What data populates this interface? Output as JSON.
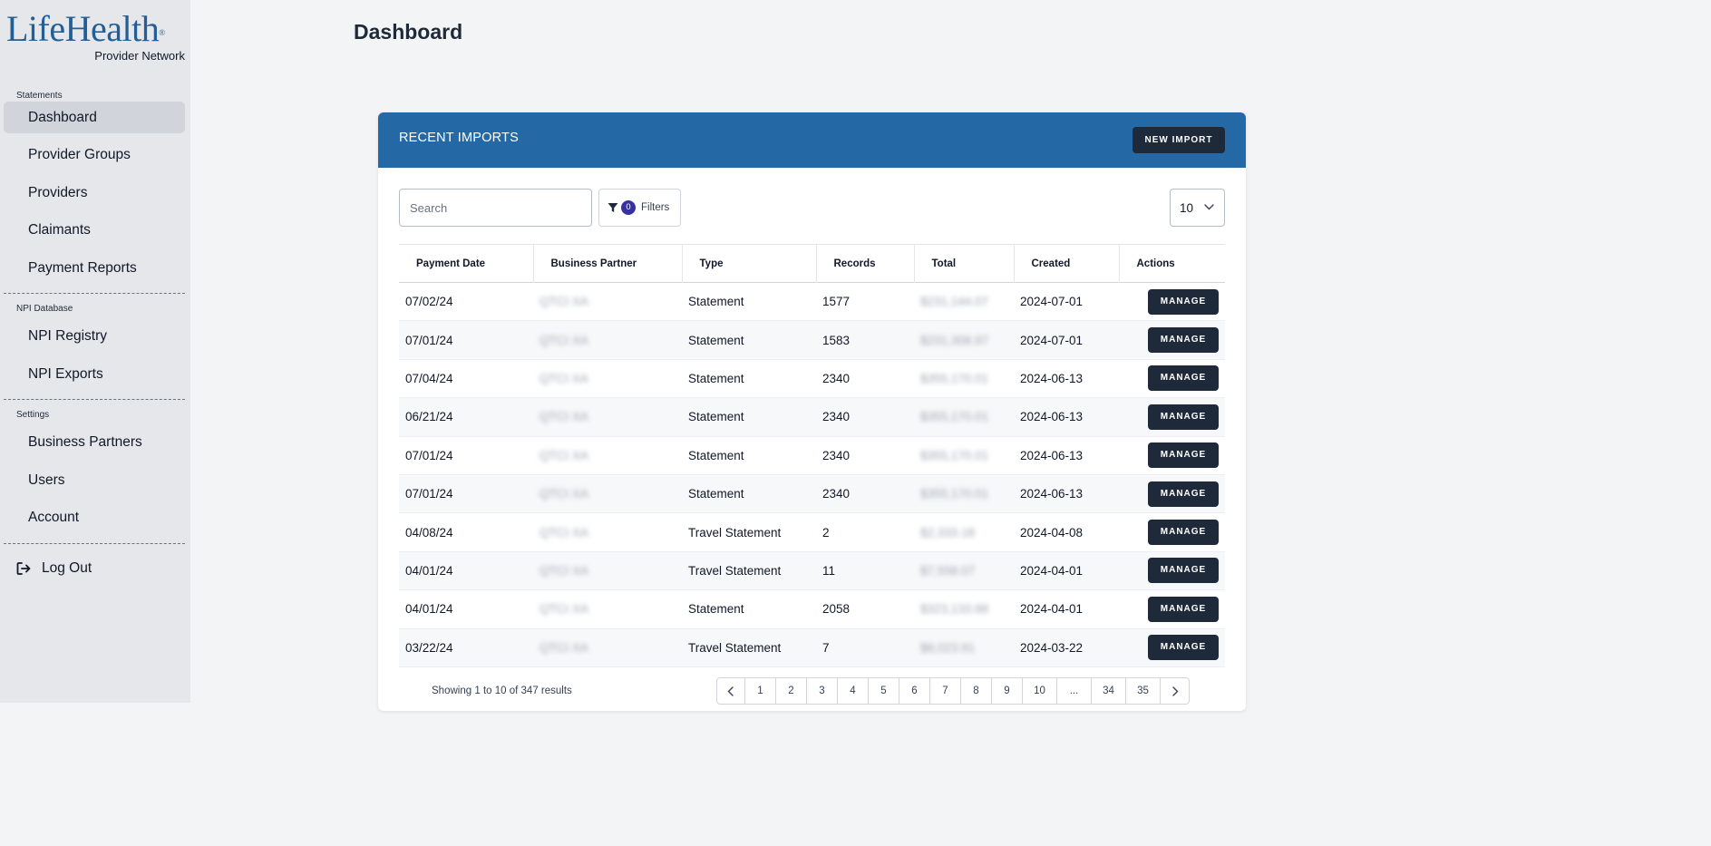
{
  "brand": {
    "name": "LifeHealth",
    "registered": "®",
    "subtitle": "Provider Network"
  },
  "sidebar": {
    "sections": [
      {
        "label": "Statements",
        "items": [
          "Dashboard",
          "Provider Groups",
          "Providers",
          "Claimants",
          "Payment Reports"
        ]
      },
      {
        "label": "NPI Database",
        "items": [
          "NPI Registry",
          "NPI Exports"
        ]
      },
      {
        "label": "Settings",
        "items": [
          "Business Partners",
          "Users",
          "Account"
        ]
      }
    ],
    "active_item": "Dashboard",
    "logout_label": "Log Out"
  },
  "page": {
    "title": "Dashboard"
  },
  "card": {
    "title": "RECENT IMPORTS",
    "new_import_label": "NEW IMPORT",
    "search_placeholder": "Search",
    "filter_count": "0",
    "filters_label": "Filters",
    "per_page": "10"
  },
  "table": {
    "columns": [
      "Payment Date",
      "Business Partner",
      "Type",
      "Records",
      "Total",
      "Created",
      "Actions"
    ],
    "action_label": "MANAGE",
    "rows": [
      {
        "payment_date": "07/02/24",
        "partner": "QTCI XA",
        "type": "Statement",
        "records": "1577",
        "total": "$231,144.07",
        "created": "2024-07-01"
      },
      {
        "payment_date": "07/01/24",
        "partner": "QTCI XA",
        "type": "Statement",
        "records": "1583",
        "total": "$231,308.97",
        "created": "2024-07-01"
      },
      {
        "payment_date": "07/04/24",
        "partner": "QTCI XA",
        "type": "Statement",
        "records": "2340",
        "total": "$355,170.01",
        "created": "2024-06-13"
      },
      {
        "payment_date": "06/21/24",
        "partner": "QTCI XA",
        "type": "Statement",
        "records": "2340",
        "total": "$355,170.01",
        "created": "2024-06-13"
      },
      {
        "payment_date": "07/01/24",
        "partner": "QTCI XA",
        "type": "Statement",
        "records": "2340",
        "total": "$355,170.01",
        "created": "2024-06-13"
      },
      {
        "payment_date": "07/01/24",
        "partner": "QTCI XA",
        "type": "Statement",
        "records": "2340",
        "total": "$355,170.01",
        "created": "2024-06-13"
      },
      {
        "payment_date": "04/08/24",
        "partner": "QTCI XA",
        "type": "Travel Statement",
        "records": "2",
        "total": "$2,333.18",
        "created": "2024-04-08"
      },
      {
        "payment_date": "04/01/24",
        "partner": "QTCI XA",
        "type": "Travel Statement",
        "records": "11",
        "total": "$7,558.07",
        "created": "2024-04-01"
      },
      {
        "payment_date": "04/01/24",
        "partner": "QTCI XA",
        "type": "Statement",
        "records": "2058",
        "total": "$323,133.88",
        "created": "2024-04-01"
      },
      {
        "payment_date": "03/22/24",
        "partner": "QTCI XA",
        "type": "Travel Statement",
        "records": "7",
        "total": "$8,023.91",
        "created": "2024-03-22"
      }
    ]
  },
  "pagination": {
    "showing_prefix": "Showing",
    "from": "1",
    "to": "10",
    "total": "347",
    "showing_to_word": "to",
    "showing_of_word": "of",
    "showing_suffix": "results",
    "pages": [
      "1",
      "2",
      "3",
      "4",
      "5",
      "6",
      "7",
      "8",
      "9",
      "10",
      "...",
      "34",
      "35"
    ],
    "prev_icon": "chevron-left-icon",
    "next_icon": "chevron-right-icon"
  }
}
